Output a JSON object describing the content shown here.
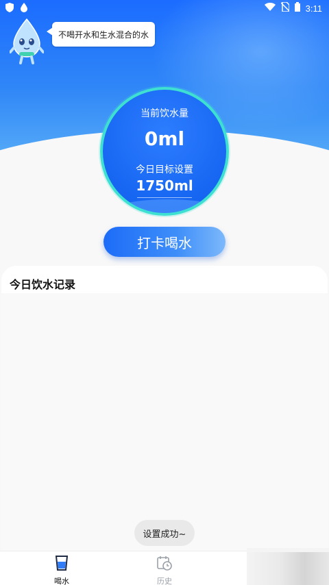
{
  "status_bar": {
    "time": "3:11",
    "left_icons": [
      "shield-icon",
      "water-drop-icon"
    ],
    "right_icons": [
      "wifi-icon",
      "no-sim-icon",
      "battery-icon"
    ]
  },
  "header": {
    "tip_text": "不喝开水和生水混合的水"
  },
  "meter": {
    "current_label": "当前饮水量",
    "current_value": "0ml",
    "target_label": "今日目标设置",
    "target_value": "1750ml"
  },
  "actions": {
    "checkin_label": "打卡喝水"
  },
  "records": {
    "title": "今日饮水记录",
    "items": []
  },
  "toast": {
    "message": "设置成功~"
  },
  "bottom_nav": {
    "items": [
      {
        "label": "喝水",
        "icon": "water-glass-icon",
        "active": true
      },
      {
        "label": "历史",
        "icon": "calendar-clock-icon",
        "active": false
      }
    ]
  },
  "colors": {
    "primary": "#1766f2",
    "ring": "#3ee0d2",
    "header_top": "#1b6cff",
    "background": "#f8f8f8"
  }
}
